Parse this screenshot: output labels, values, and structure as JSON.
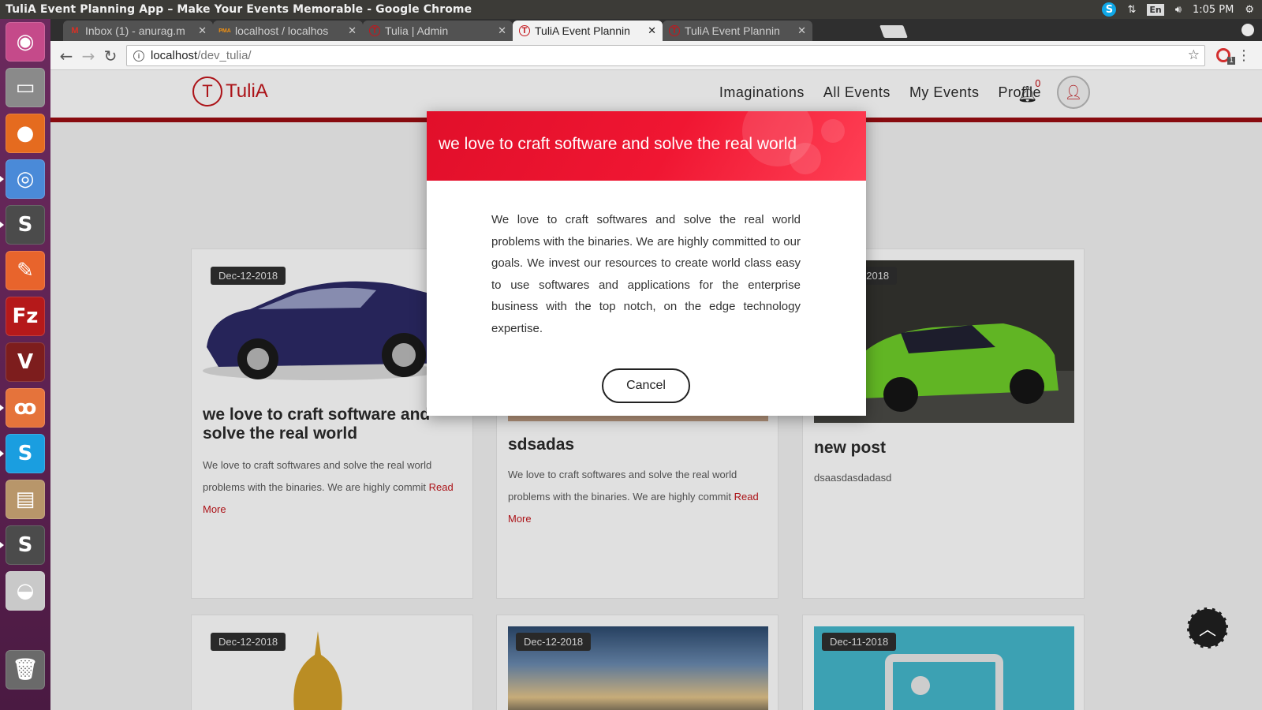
{
  "os": {
    "window_title": "TuliA Event Planning App – Make Your Events Memorable - Google Chrome",
    "clock": "1:05 PM",
    "keyboard_layout": "En",
    "launcher_apps": [
      {
        "name": "ubuntu-dash-icon",
        "glyph": "◉",
        "color": "#c54a8a"
      },
      {
        "name": "file-manager-icon",
        "glyph": "▭",
        "color": "#8a8a8a"
      },
      {
        "name": "firefox-icon",
        "glyph": "●",
        "color": "#e56b1f"
      },
      {
        "name": "chrome-icon",
        "glyph": "◎",
        "color": "#4a8ad8"
      },
      {
        "name": "sublime-text-icon",
        "glyph": "S",
        "color": "#4b4b4b"
      },
      {
        "name": "postman-icon",
        "glyph": "✎",
        "color": "#e8642c"
      },
      {
        "name": "filezilla-icon",
        "glyph": "Fz",
        "color": "#b5191a"
      },
      {
        "name": "vim-icon",
        "glyph": "V",
        "color": "#7d1d1d"
      },
      {
        "name": "xampp-icon",
        "glyph": "ꝏ",
        "color": "#e5733b"
      },
      {
        "name": "skype-icon",
        "glyph": "S",
        "color": "#1a9ee0"
      },
      {
        "name": "archive-manager-icon",
        "glyph": "▤",
        "color": "#b8966a"
      },
      {
        "name": "sublime-text-2-icon",
        "glyph": "S",
        "color": "#4b4b4b"
      },
      {
        "name": "disk-drive-icon",
        "glyph": "◒",
        "color": "#c9c9c9"
      },
      {
        "name": "trash-icon",
        "glyph": "🗑",
        "color": "#6a6a6a"
      }
    ]
  },
  "browser": {
    "tabs": [
      {
        "label": "Inbox (1) - anurag.m",
        "favicon": "M",
        "favicon_color": "#d93025"
      },
      {
        "label": "localhost / localhos",
        "favicon": "PMA",
        "favicon_color": "#f29111"
      },
      {
        "label": "Tulia | Admin",
        "favicon": "T",
        "favicon_color": "#c4161c"
      },
      {
        "label": "TuliA Event Plannin",
        "favicon": "T",
        "favicon_color": "#c4161c",
        "active": true
      },
      {
        "label": "TuliA Event Plannin",
        "favicon": "T",
        "favicon_color": "#c4161c"
      }
    ],
    "url_host": "localhost",
    "url_path": "/dev_tulia/",
    "extension_badge": "1"
  },
  "site": {
    "logo_text": "TuliA",
    "logo_mark": "T",
    "nav": [
      "Imaginations",
      "All Events",
      "My Events",
      "Profile"
    ],
    "notification_count": "0",
    "accent_color": "#c4161c"
  },
  "cards": [
    {
      "date": "Dec-12-2018",
      "title": "we love to craft software and solve the real world",
      "excerpt": "We love to craft softwares and solve the real world problems with the binaries. We are highly commit",
      "read_more": "Read More",
      "image": "purple-convertible-car"
    },
    {
      "date": "",
      "title": "sdsadas",
      "excerpt": "We love to craft softwares and solve the real world problems with the binaries. We are highly commit",
      "read_more": "Read More",
      "image": "event-photo"
    },
    {
      "date": "Dec-12-2018",
      "title": "new post",
      "excerpt": "dsaasdasdadasd",
      "read_more": "",
      "image": "green-lamborghini"
    },
    {
      "date": "Dec-12-2018",
      "image": "golden-lamp"
    },
    {
      "date": "Dec-12-2018",
      "image": "sunset-sky"
    },
    {
      "date": "Dec-11-2018",
      "image": "placeholder-image"
    }
  ],
  "modal": {
    "title": "we love to craft software and solve the real world",
    "body": "We love to craft softwares and solve the real world problems with the binaries. We are highly committed to our goals. We invest our resources to create world class easy to use softwares and applications for the enterprise business with the top notch, on the edge technology expertise.",
    "cancel_label": "Cancel"
  }
}
